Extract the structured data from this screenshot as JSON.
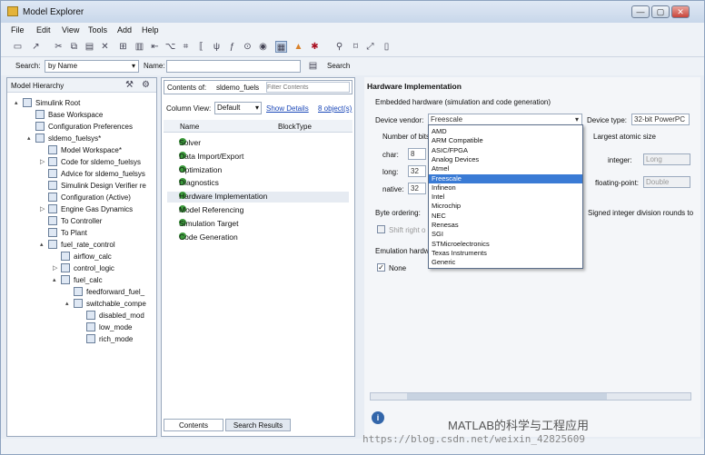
{
  "window": {
    "title": "Model Explorer",
    "buttons": [
      "—",
      "▢",
      "✕"
    ]
  },
  "menu": [
    "File",
    "Edit",
    "View",
    "Tools",
    "Add",
    "Help"
  ],
  "search": {
    "label": "Search:",
    "by": "by Name",
    "name_label": "Name:",
    "button": "Search"
  },
  "hierarchy": {
    "title": "Model Hierarchy",
    "items": [
      "Simulink Root",
      "Base Workspace",
      "Configuration Preferences",
      "sldemo_fuelsys*",
      "Model Workspace*",
      "Code for sldemo_fuelsys",
      "Advice for sldemo_fuelsys",
      "Simulink Design Verifier re",
      "Configuration (Active)",
      "Engine Gas Dynamics",
      "To Controller",
      "To Plant",
      "fuel_rate_control",
      "airflow_calc",
      "control_logic",
      "fuel_calc",
      "feedforward_fuel_",
      "switchable_compe",
      "disabled_mod",
      "low_mode",
      "rich_mode"
    ]
  },
  "contents": {
    "label": "Contents of:",
    "model": "sldemo_fuels",
    "filter_placeholder": "Filter Contents",
    "column_view_label": "Column View:",
    "column_view": "Default",
    "show_details": "Show Details",
    "object_count": "8 object(s)",
    "col_name": "Name",
    "col_blocktype": "BlockType",
    "items": [
      "Solver",
      "Data Import/Export",
      "Optimization",
      "Diagnostics",
      "Hardware Implementation",
      "Model Referencing",
      "Simulation Target",
      "Code Generation"
    ],
    "tabs": [
      "Contents",
      "Search Results"
    ]
  },
  "hw": {
    "title": "Hardware Implementation",
    "subtitle": "Embedded hardware (simulation and code generation)",
    "vendor_label": "Device vendor:",
    "vendor_value": "Freescale",
    "type_label": "Device type:",
    "type_value": "32-bit PowerPC",
    "bits_label": "Number of bits",
    "largest_label": "Largest atomic size",
    "char_label": "char:",
    "char_value": "8",
    "long_label": "long:",
    "long_value": "32",
    "native_label": "native:",
    "native_value": "32",
    "integer_label": "integer:",
    "integer_value": "Long",
    "fp_label": "floating-point:",
    "fp_value": "Double",
    "byte_label": "Byte ordering:",
    "signed_label": "Signed integer division rounds to",
    "shift_label": "Shift right o",
    "emul_label": "Emulation hardw",
    "none_label": "None",
    "vendors": [
      "AMD",
      "ARM Compatible",
      "ASIC/FPGA",
      "Analog Devices",
      "Atmel",
      "Freescale",
      "Infineon",
      "Intel",
      "Microchip",
      "NEC",
      "Renesas",
      "SGI",
      "STMicroelectronics",
      "Texas Instruments",
      "Generic"
    ]
  },
  "watermark": {
    "text": "MATLAB的科学与工程应用",
    "url": "https://blog.csdn.net/weixin_42825609"
  }
}
